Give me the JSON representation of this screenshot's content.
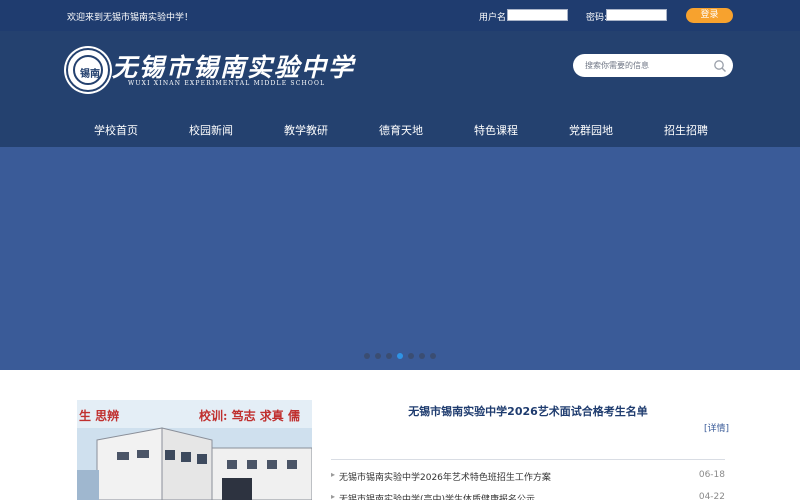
{
  "topbar": {
    "welcome": "欢迎来到无锡市锡南实验中学！",
    "username_label": "用户名:",
    "password_label": "密码:",
    "login_button": "登录"
  },
  "header": {
    "school_name": "无锡市锡南实验中学",
    "school_name_en": "WUXI XINAN EXPERIMENTAL MIDDLE SCHOOL",
    "logo_mark": "锡南",
    "search_placeholder": "搜索你需要的信息"
  },
  "nav": {
    "items": [
      "学校首页",
      "校园新闻",
      "教学教研",
      "德育天地",
      "特色课程",
      "党群园地",
      "招生招聘"
    ]
  },
  "banner": {
    "slide_count": 7,
    "active_slide": 4
  },
  "content": {
    "photo_text_left": "生 思辨",
    "photo_text_right": "校训: 笃志 求真 儒",
    "headline": "无锡市锡南实验中学2026艺术面试合格考生名单",
    "detail_link": "[详情]",
    "news": [
      {
        "title": "无锡市锡南实验中学2026年艺术特色班招生工作方案",
        "date": "06-18"
      },
      {
        "title": "无锡市锡南实验中学(高中)学生体质健康报名公示",
        "date": "04-22"
      }
    ]
  },
  "colors": {
    "topbar": "#1f3c6f",
    "header": "#24416f",
    "banner": "#3a5b98",
    "accent": "#f7a22e",
    "active_dot": "#2e93e5"
  }
}
